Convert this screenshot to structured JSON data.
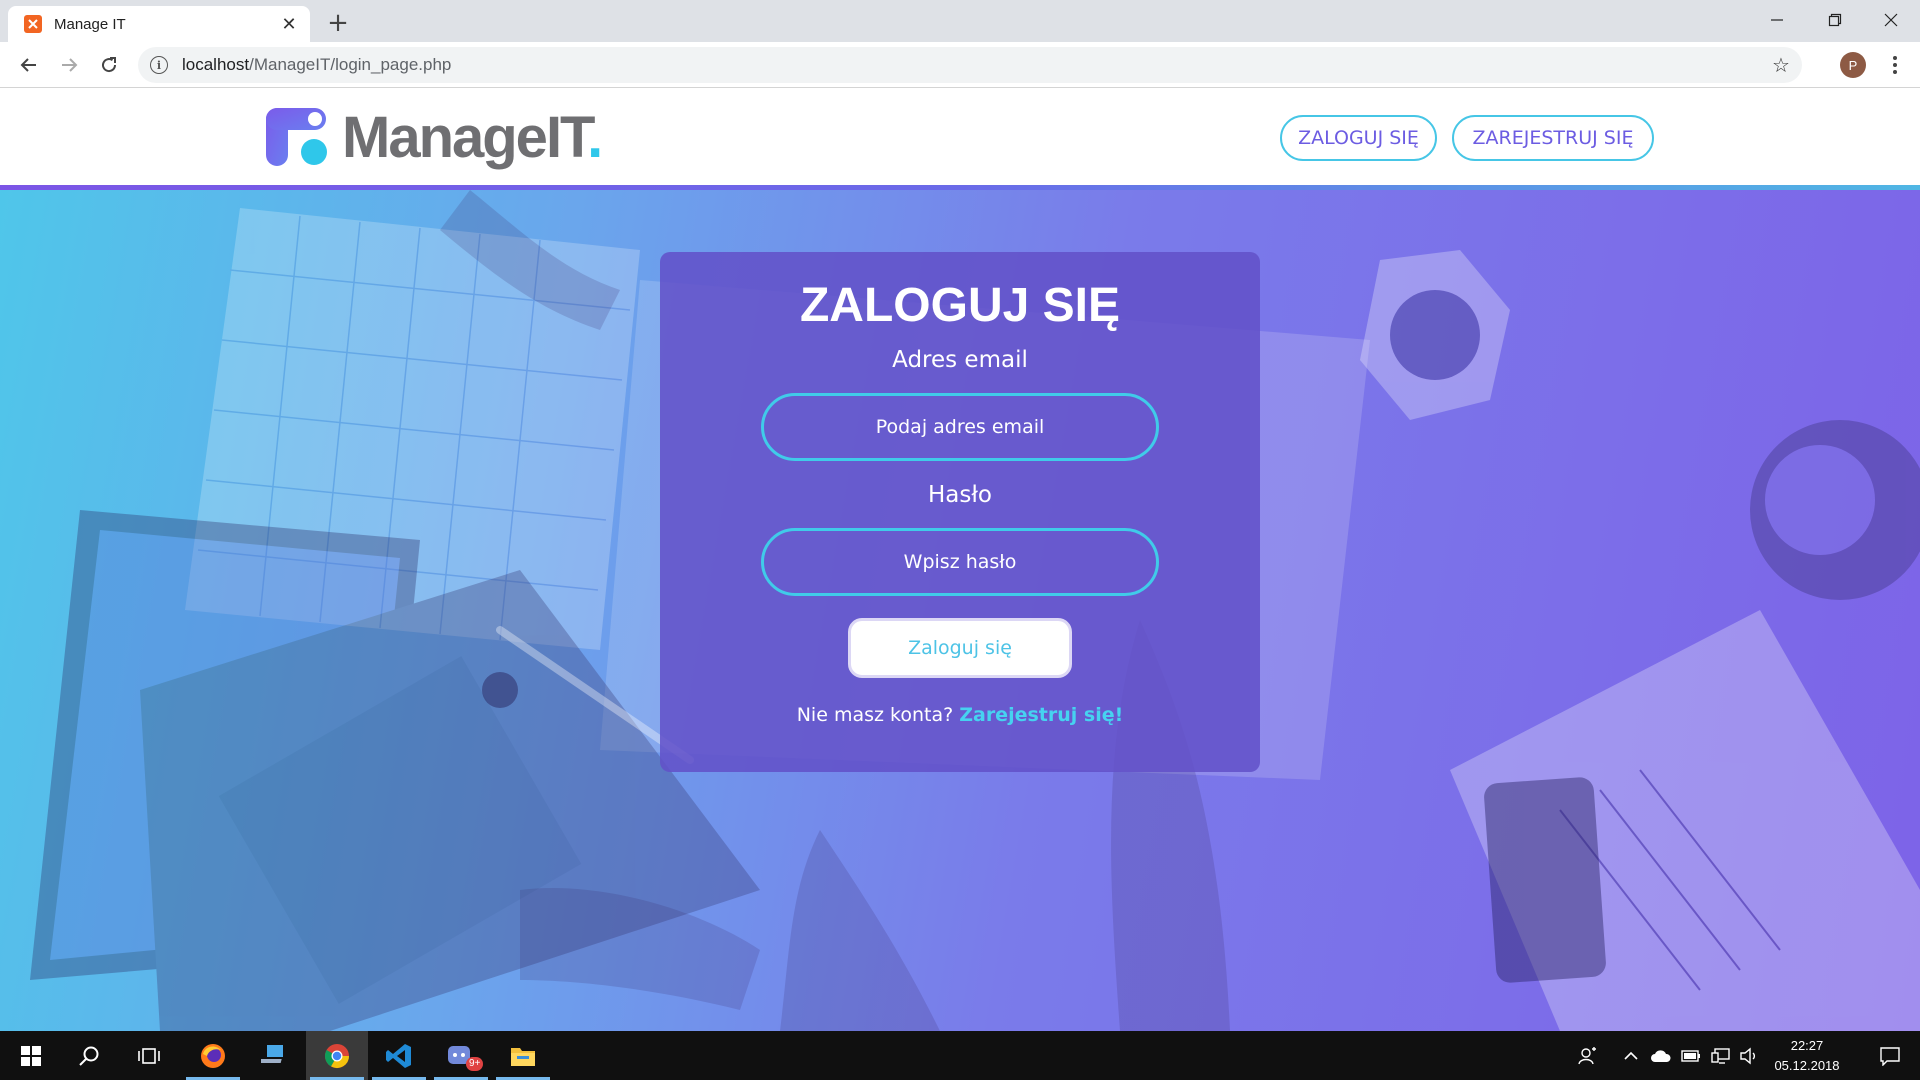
{
  "browser": {
    "tab_title": "Manage IT",
    "tab_close": "✕",
    "new_tab": "+",
    "url_host": "localhost",
    "url_path": "/ManageIT/login_page.php",
    "profile_initial": "P"
  },
  "header": {
    "logo_text": "ManageIT",
    "logo_dot": ".",
    "login_button": "ZALOGUJ SIĘ",
    "register_button": "ZAREJESTRUJ SIĘ"
  },
  "login": {
    "title": "ZALOGUJ SIĘ",
    "email_label": "Adres email",
    "email_placeholder": "Podaj adres email",
    "password_label": "Hasło",
    "password_placeholder": "Wpisz hasło",
    "submit_label": "Zaloguj się",
    "no_account_text": "Nie masz konta? ",
    "register_link": "Zarejestruj się!"
  },
  "taskbar": {
    "time": "22:27",
    "date": "05.12.2018",
    "notification_badge": "9+"
  },
  "colors": {
    "accent_purple": "#6c5ce2",
    "accent_cyan": "#46c6e6",
    "card": "#6250c8"
  }
}
